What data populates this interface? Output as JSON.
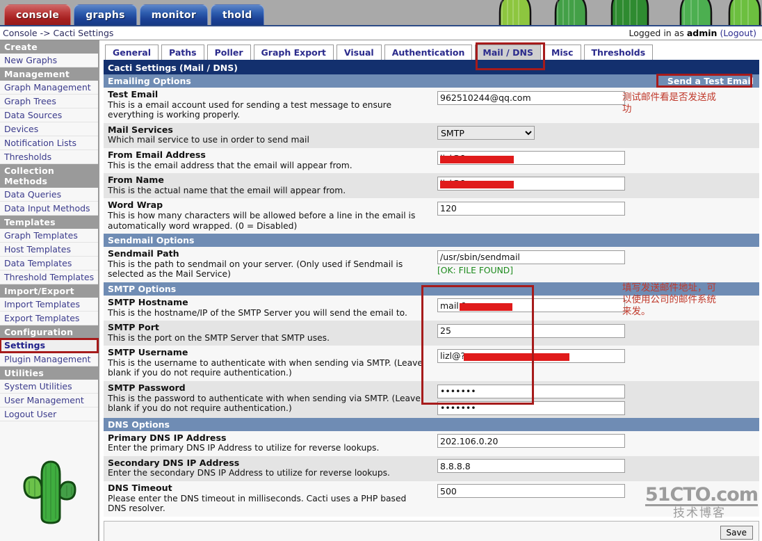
{
  "header": {
    "tabs": [
      {
        "label": "console",
        "active": true
      },
      {
        "label": "graphs",
        "active": false
      },
      {
        "label": "monitor",
        "active": false
      },
      {
        "label": "thold",
        "active": false
      }
    ],
    "breadcrumb": "Console -> Cacti Settings",
    "login_prefix": "Logged in as",
    "login_user": "admin",
    "logout_label": "(Logout)"
  },
  "sidebar": {
    "groups": [
      {
        "heading": "Create",
        "items": [
          "New Graphs"
        ]
      },
      {
        "heading": "Management",
        "items": [
          "Graph Management",
          "Graph Trees",
          "Data Sources",
          "Devices",
          "Notification Lists",
          "Thresholds"
        ]
      },
      {
        "heading": "Collection Methods",
        "items": [
          "Data Queries",
          "Data Input Methods"
        ]
      },
      {
        "heading": "Templates",
        "items": [
          "Graph Templates",
          "Host Templates",
          "Data Templates",
          "Threshold Templates"
        ]
      },
      {
        "heading": "Import/Export",
        "items": [
          "Import Templates",
          "Export Templates"
        ]
      },
      {
        "heading": "Configuration",
        "items": [
          "Settings",
          "Plugin Management"
        ]
      },
      {
        "heading": "Utilities",
        "items": [
          "System Utilities",
          "User Management",
          "Logout User"
        ]
      }
    ],
    "selected_item": "Settings",
    "logo": "cactus-logo"
  },
  "settings_tabs": [
    {
      "label": "General",
      "active": false
    },
    {
      "label": "Paths",
      "active": false
    },
    {
      "label": "Poller",
      "active": false
    },
    {
      "label": "Graph Export",
      "active": false
    },
    {
      "label": "Visual",
      "active": false
    },
    {
      "label": "Authentication",
      "active": false
    },
    {
      "label": "Mail / DNS",
      "active": true
    },
    {
      "label": "Misc",
      "active": false
    },
    {
      "label": "Thresholds",
      "active": false
    }
  ],
  "page_title": "Cacti Settings (Mail / DNS)",
  "sections": {
    "emailing": {
      "heading": "Emailing Options",
      "test_email_button": "Send a Test Email",
      "rows": [
        {
          "label": "Test Email",
          "desc": "This is a email account used for sending a test message to ensure everything is working properly.",
          "value": "962510244@qq.com",
          "type": "text"
        },
        {
          "label": "Mail Services",
          "desc": "Which mail service to use in order to send mail",
          "value": "SMTP",
          "type": "select",
          "options": [
            "SMTP"
          ]
        },
        {
          "label": "From Email Address",
          "desc": "This is the email address that the email will appear from.",
          "value": "lizl@?",
          "type": "text",
          "redacted": true
        },
        {
          "label": "From Name",
          "desc": "This is the actual name that the email will appear from.",
          "value": "lizl@?",
          "type": "text",
          "redacted": true
        },
        {
          "label": "Word Wrap",
          "desc": "This is how many characters will be allowed before a line in the email is automatically word wrapped. (0 = Disabled)",
          "value": "120",
          "type": "text"
        }
      ]
    },
    "sendmail": {
      "heading": "Sendmail Options",
      "rows": [
        {
          "label": "Sendmail Path",
          "desc": "This is the path to sendmail on your server. (Only used if Sendmail is selected as the Mail Service)",
          "value": "/usr/sbin/sendmail",
          "status": "[OK: FILE FOUND]",
          "type": "text"
        }
      ]
    },
    "smtp": {
      "heading": "SMTP Options",
      "rows": [
        {
          "label": "SMTP Hostname",
          "desc": "This is the hostname/IP of the SMTP Server you will send the email to.",
          "value": "mail.?",
          "type": "text",
          "redacted": true
        },
        {
          "label": "SMTP Port",
          "desc": "This is the port on the SMTP Server that SMTP uses.",
          "value": "25",
          "type": "text"
        },
        {
          "label": "SMTP Username",
          "desc": "This is the username to authenticate with when sending via SMTP. (Leave blank if you do not require authentication.)",
          "value": "lizl@?",
          "type": "text",
          "redacted": true
        },
        {
          "label": "SMTP Password",
          "desc": "This is the password to authenticate with when sending via SMTP. (Leave blank if you do not require authentication.)",
          "value": "•••••••",
          "value2": "•••••••",
          "type": "password"
        }
      ]
    },
    "dns": {
      "heading": "DNS Options",
      "rows": [
        {
          "label": "Primary DNS IP Address",
          "desc": "Enter the primary DNS IP Address to utilize for reverse lookups.",
          "value": "202.106.0.20",
          "type": "text"
        },
        {
          "label": "Secondary DNS IP Address",
          "desc": "Enter the secondary DNS IP Address to utilize for reverse lookups.",
          "value": "8.8.8.8",
          "type": "text"
        },
        {
          "label": "DNS Timeout",
          "desc": "Please enter the DNS timeout in milliseconds. Cacti uses a PHP based DNS resolver.",
          "value": "500",
          "type": "text"
        }
      ]
    }
  },
  "annotations": {
    "test_email_note": "测试邮件看是否发送成功",
    "smtp_note": "填写发送邮件地址，可以使用公司的邮件系统来发。"
  },
  "footer": {
    "save_label": "Save",
    "watermark_main": "51CTO.com",
    "watermark_sub": "技术博客"
  },
  "colors": {
    "title_bar": "#13306e",
    "section_bar": "#6f8cb4",
    "annotation_red": "#a61b1b",
    "annotation_text": "#c0392b",
    "ok_green": "#1c8a1c",
    "nav_heading": "#9a9a9a",
    "link": "#3b3b8c"
  }
}
